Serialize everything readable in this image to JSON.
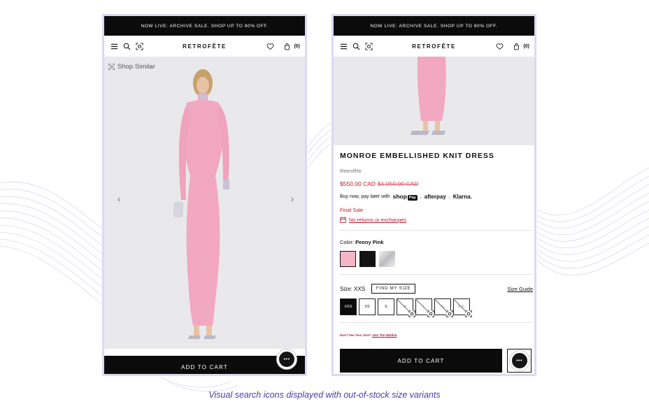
{
  "promo": "NOW LIVE: ARCHIVE SALE. SHOP UP TO 80% OFF.",
  "brand": "RETROFÊTE",
  "cart_count": "(0)",
  "left": {
    "shop_similar": "Shop Similar",
    "add_to_cart": "ADD TO CART"
  },
  "product": {
    "title": "MONROE EMBELLISHED KNIT DRESS",
    "brand": "Retrofête",
    "price": "$550.00 CAD",
    "original_price": "$1,050.00 CAD",
    "bnpl_prefix": "Buy now, pay later with",
    "shop_pay": "shop",
    "shop_pay_badge": "Pay",
    "afterpay": "afterpay",
    "klarna": "Klarna.",
    "sep": ",",
    "sep2": ".",
    "final_sale": "Final Sale",
    "returns": "No returns or exchanges",
    "color_label": "Color:",
    "color_value": "Peony Pink",
    "swatches": [
      {
        "name": "Peony Pink",
        "color": "#f4b6c6"
      },
      {
        "name": "Black",
        "color": "#141414"
      },
      {
        "name": "Silver",
        "color": "#cfcfd1"
      }
    ],
    "size_label": "Size:",
    "size_value": "XXS",
    "find_size": "FIND MY SIZE",
    "size_guide": "Size Guide",
    "sizes": [
      {
        "label": "XXS",
        "state": "selected"
      },
      {
        "label": "XS",
        "state": "available"
      },
      {
        "label": "S",
        "state": "available"
      },
      {
        "label": "M",
        "state": "out-of-stock"
      },
      {
        "label": "L",
        "state": "out-of-stock"
      },
      {
        "label": "XL",
        "state": "out-of-stock"
      },
      {
        "label": "XXL",
        "state": "out-of-stock"
      }
    ],
    "waitlist_text": "Don't See Your Size?",
    "waitlist_link": "Join The Waitlist",
    "add_to_cart": "ADD TO CART"
  },
  "caption": "Visual search icons displayed with out-of-stock size variants",
  "colors": {
    "accent_sale": "#c9182b",
    "frame": "#ddd8f4",
    "caption": "#4a3fa2"
  }
}
